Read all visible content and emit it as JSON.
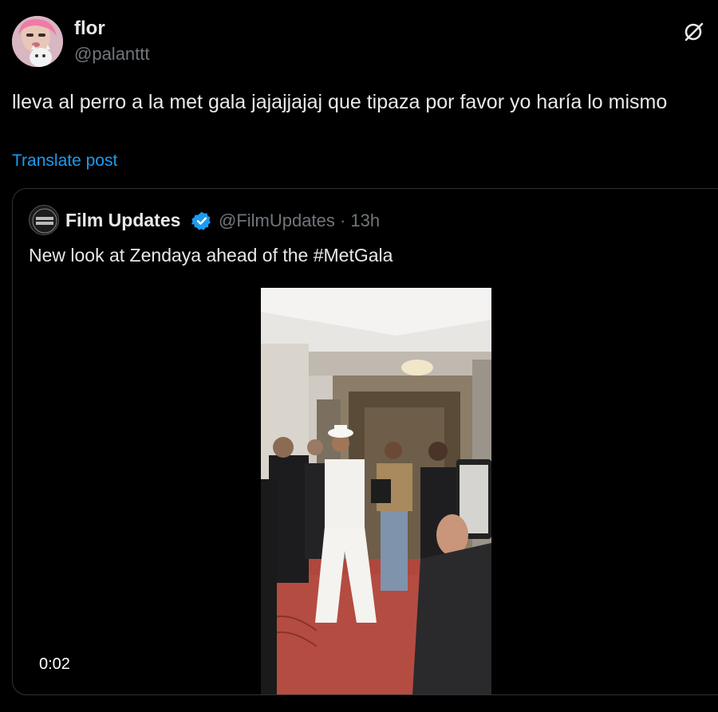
{
  "author": {
    "display_name": "flor",
    "handle": "@palanttt",
    "avatar_icon": "avatar-photo"
  },
  "post": {
    "text": "lleva al perro a la met gala jajajjajaj que tipaza por favor yo haría lo mismo",
    "translate_label": "Translate post",
    "grok_icon": "grok-icon"
  },
  "quoted_post": {
    "display_name": "Film Updates",
    "verified": true,
    "handle": "@FilmUpdates",
    "separator": "·",
    "time": "13h",
    "text": "New look at Zendaya ahead of the #MetGala",
    "video_duration": "0:02"
  },
  "colors": {
    "background": "#000000",
    "text_primary": "#e7e9ea",
    "text_secondary": "#71767b",
    "link": "#1d9bf0",
    "verified": "#1d9bf0",
    "border": "#2f3336"
  }
}
